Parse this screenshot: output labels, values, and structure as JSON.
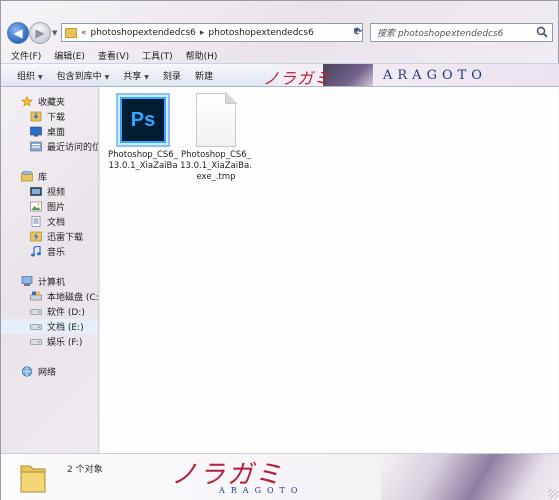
{
  "address_bar": {
    "prefix": "«",
    "segments": [
      "photoshopextendedcs6",
      "photoshopextendedcs6"
    ],
    "separator": "▸"
  },
  "search": {
    "placeholder": "搜索 photoshopextendedcs6"
  },
  "menu": [
    "文件(F)",
    "编辑(E)",
    "查看(V)",
    "工具(T)",
    "帮助(H)"
  ],
  "toolbar": {
    "items": [
      "组织",
      "包含到库中",
      "共享",
      "刻录",
      "新建"
    ],
    "banner_title": "ノラガミ",
    "banner_sub": "ARAGOTO"
  },
  "navigation": {
    "favorites": {
      "label": "收藏夹",
      "items": [
        "下载",
        "桌面",
        "最近访问的位"
      ]
    },
    "libraries": {
      "label": "库",
      "items": [
        "视频",
        "图片",
        "文档",
        "迅雷下载",
        "音乐"
      ]
    },
    "computer": {
      "label": "计算机",
      "items": [
        "本地磁盘 (C:)",
        "软件 (D:)",
        "文档 (E:)",
        "娱乐 (F:)"
      ],
      "selected": "文档 (E:)"
    },
    "network": {
      "label": "网络"
    }
  },
  "files": [
    {
      "name": "Photoshop_CS6_13.0.1_XiaZaiBa",
      "icon": "photoshop-icon",
      "icon_text": "Ps"
    },
    {
      "name": "Photoshop_CS6_13.0.1_XiaZaiBa.exe_.tmp",
      "icon": "blank-file-icon"
    }
  ],
  "status": {
    "count": "2 个对象",
    "art_title": "ノラガミ",
    "art_sub": "ARAGOTO"
  },
  "colors": {
    "accent_red": "#b2203a",
    "accent_blue": "#1d3a8a",
    "ps_blue": "#31a8ff",
    "ps_dark": "#001d34"
  }
}
